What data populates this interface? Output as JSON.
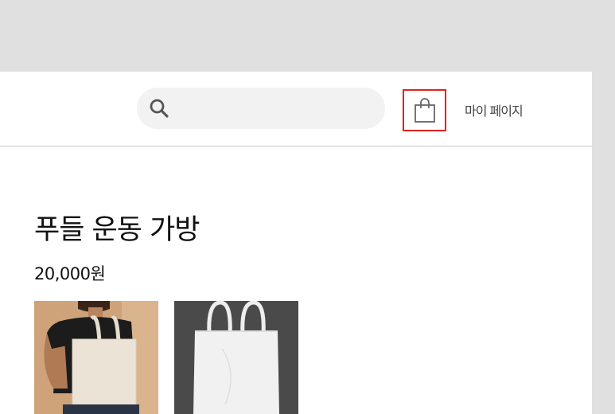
{
  "header": {
    "search": {
      "placeholder": "",
      "value": ""
    },
    "cart_icon": "shopping-bag-icon",
    "cart_highlight_color": "#e2231a",
    "mypage_label": "마이 페이지"
  },
  "product": {
    "title": "푸들 운동 가방",
    "price": "20,000원",
    "images": [
      {
        "description_icon": "person-carrying-tote-bag-photo"
      },
      {
        "description_icon": "white-tote-bag-on-dark-photo"
      }
    ]
  },
  "colors": {
    "background": "#e0e0e0",
    "page": "#ffffff",
    "search_bg": "#f2f2f2",
    "accent_border": "#e2231a"
  }
}
